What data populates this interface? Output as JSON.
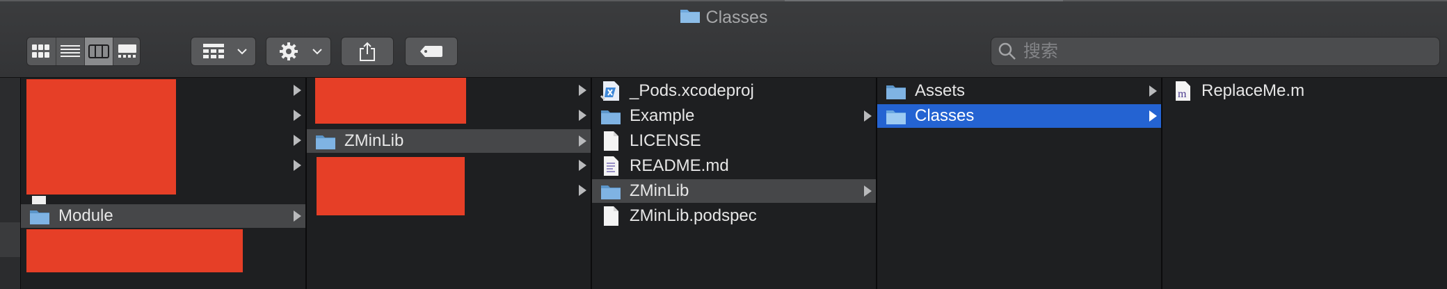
{
  "window": {
    "title": "Classes"
  },
  "toolbar": {
    "view_buttons": [
      "icon-view",
      "list-view",
      "column-view",
      "gallery-view"
    ],
    "group_button": "group-by",
    "action_button": "action-gear",
    "share_button": "share",
    "tag_button": "tag"
  },
  "search": {
    "placeholder": "搜索"
  },
  "columns": [
    {
      "items": [
        {
          "label": "Module",
          "selected": true
        }
      ]
    },
    {
      "items": [
        {
          "label": "ZMinLib",
          "selected": true
        }
      ]
    },
    {
      "items": [
        {
          "label": "_Pods.xcodeproj"
        },
        {
          "label": "Example"
        },
        {
          "label": "LICENSE"
        },
        {
          "label": "README.md"
        },
        {
          "label": "ZMinLib",
          "selected": true
        },
        {
          "label": "ZMinLib.podspec"
        }
      ]
    },
    {
      "items": [
        {
          "label": "Assets"
        },
        {
          "label": "Classes",
          "selected": true
        }
      ]
    },
    {
      "items": [
        {
          "label": "ReplaceMe.m"
        }
      ]
    }
  ],
  "colors": {
    "selection_active": "#2463d2",
    "selection_inactive": "#464749",
    "folder": "#6fa8dc",
    "redaction": "#e63f27"
  }
}
